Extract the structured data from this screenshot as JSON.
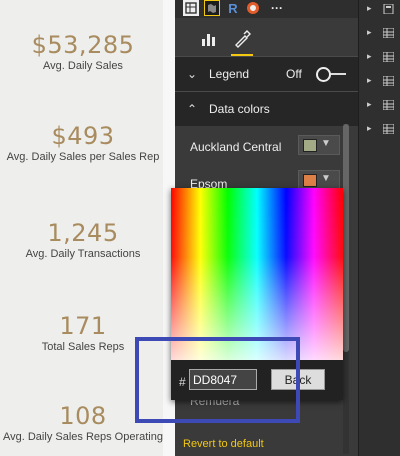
{
  "kpis": [
    {
      "value": "$53,285",
      "label": "Avg. Daily Sales"
    },
    {
      "value": "$493",
      "label": "Avg. Daily Sales per Sales Rep"
    },
    {
      "value": "1,245",
      "label": "Avg. Daily Transactions"
    },
    {
      "value": "171",
      "label": "Total Sales Reps"
    },
    {
      "value": "108",
      "label": "Avg. Daily Sales Reps Operating"
    }
  ],
  "visual_icons": [
    {
      "name": "table-visual-icon",
      "glyph": ""
    },
    {
      "name": "map-visual-icon",
      "glyph": ""
    },
    {
      "name": "r-visual-icon",
      "glyph": "R"
    },
    {
      "name": "globe-visual-icon",
      "glyph": ""
    },
    {
      "name": "more-visuals-icon",
      "glyph": "···"
    }
  ],
  "tabs": {
    "fields": "bar-chart-icon",
    "format": "paint-roller-icon"
  },
  "legend": {
    "title": "Legend",
    "state": "Off"
  },
  "data_colors": {
    "title": "Data colors",
    "items": [
      {
        "label": "Auckland Central",
        "color": "#a3ab86"
      },
      {
        "label": "Epsom",
        "color": "#dd8047"
      }
    ],
    "hidden_label": "Remuera"
  },
  "picker": {
    "hash": "#",
    "hex_value": "DD8047",
    "back_label": "Back"
  },
  "revert_label": "Revert to default",
  "field_tables": 8,
  "accent": "#f2c811",
  "highlight_color": "#3d49b5"
}
